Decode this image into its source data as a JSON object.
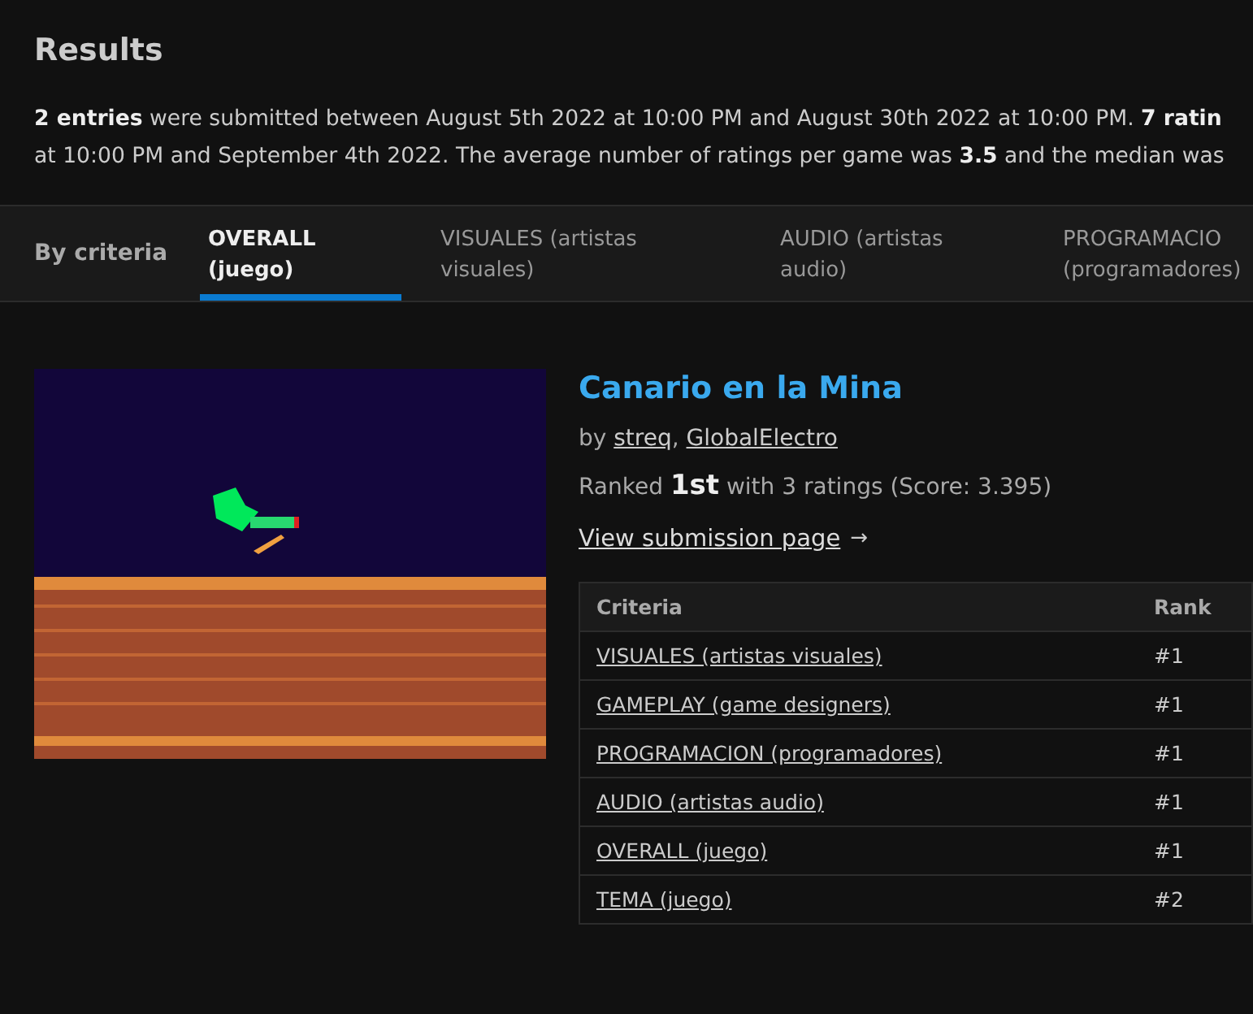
{
  "title": "Results",
  "summary_lines": [
    "**2 entries** were submitted between August 5th 2022 at 10:00 PM and August 30th 2022 at 10:00 PM. **7 ratin**",
    "at 10:00 PM and September 4th 2022. The average number of ratings per game was **3.5** and the median was"
  ],
  "tabs_label": "By criteria",
  "tabs": [
    {
      "label": "OVERALL (juego)",
      "selected": true
    },
    {
      "label": "VISUALES (artistas visuales)",
      "selected": false
    },
    {
      "label": "AUDIO (artistas audio)",
      "selected": false
    },
    {
      "label": "PROGRAMACIO (programadores)",
      "selected": false
    }
  ],
  "entry": {
    "title": "Canario en la Mina",
    "by": "by",
    "authors": [
      "streq",
      "GlobalElectro"
    ],
    "author_separator": ",",
    "ranked_prefix": "Ranked",
    "rank": "1st",
    "ranked_suffix": "with 3 ratings (Score: 3.395)",
    "link": "View submission page",
    "link_arrow": "→",
    "table": {
      "columns": [
        "Criteria",
        "Rank"
      ],
      "rows": [
        {
          "criteria": "VISUALES (artistas visuales)",
          "rank": "#1"
        },
        {
          "criteria": "GAMEPLAY (game designers)",
          "rank": "#1"
        },
        {
          "criteria": "PROGRAMACION (programadores)",
          "rank": "#1"
        },
        {
          "criteria": "AUDIO (artistas audio)",
          "rank": "#1"
        },
        {
          "criteria": "OVERALL (juego)",
          "rank": "#1"
        },
        {
          "criteria": "TEMA (juego)",
          "rank": "#2"
        }
      ]
    }
  }
}
